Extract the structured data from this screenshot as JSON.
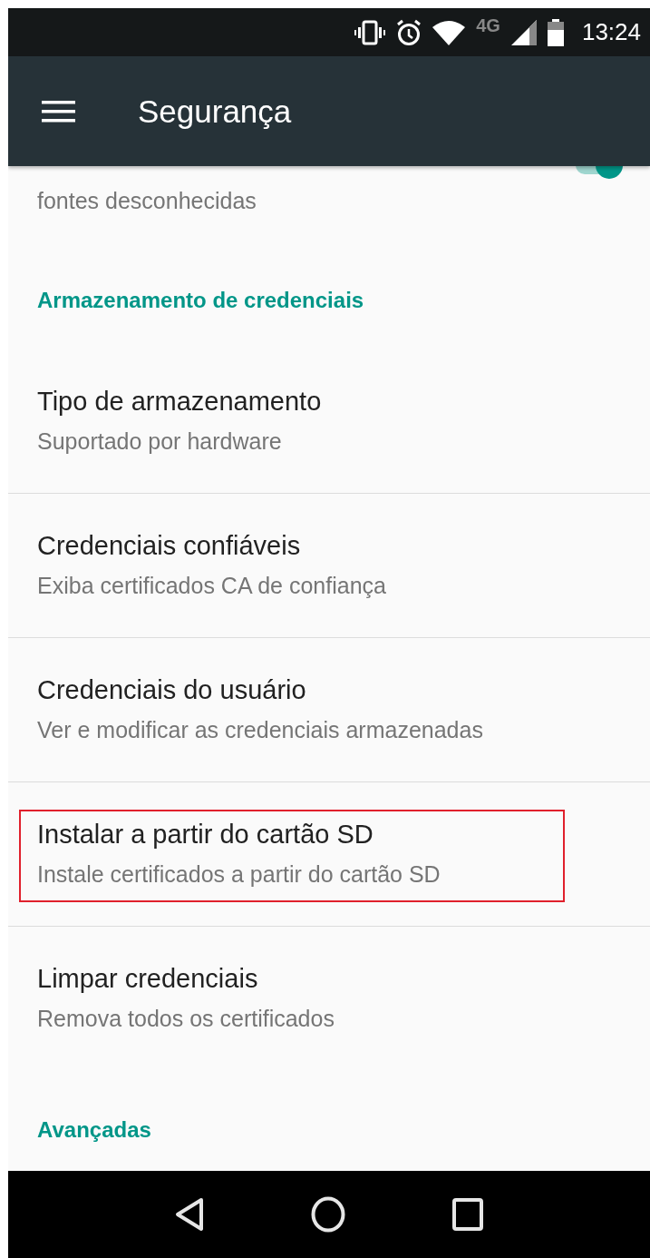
{
  "status_bar": {
    "network": "4G",
    "time": "13:24"
  },
  "app_bar": {
    "title": "Segurança"
  },
  "partial_item": {
    "summary_lines": [
      "fontes desconhecidas"
    ],
    "on": true
  },
  "sections": [
    {
      "header": "Armazenamento de credenciais",
      "items": [
        {
          "title": "Tipo de armazenamento",
          "summary": "Suportado por hardware",
          "highlighted": false
        },
        {
          "title": "Credenciais confiáveis",
          "summary": "Exiba certificados CA de confiança",
          "highlighted": false
        },
        {
          "title": "Credenciais do usuário",
          "summary": "Ver e modificar as credenciais armazenadas",
          "highlighted": false
        },
        {
          "title": "Instalar a partir do cartão SD",
          "summary": "Instale certificados a partir do cartão SD",
          "highlighted": true
        },
        {
          "title": "Limpar credenciais",
          "summary": "Remova todos os certificados",
          "highlighted": false
        }
      ]
    },
    {
      "header": "Avançadas"
    }
  ]
}
